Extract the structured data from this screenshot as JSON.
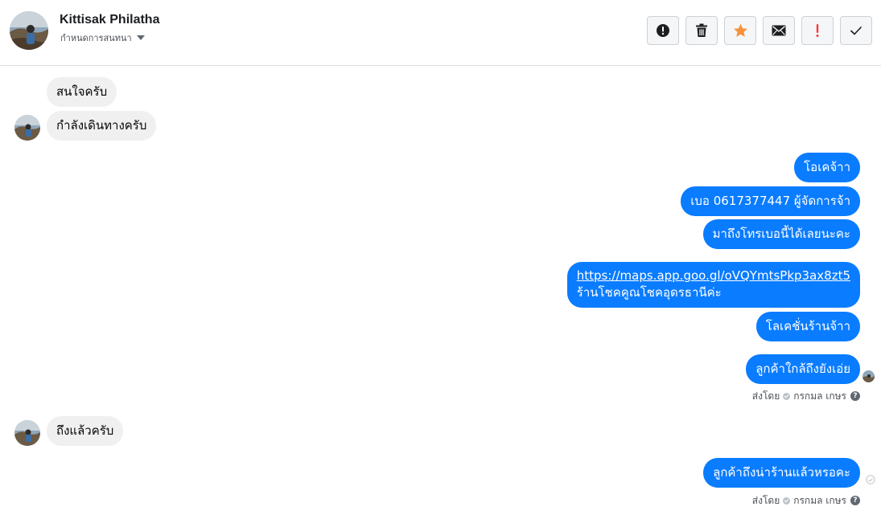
{
  "header": {
    "contact_name": "Kittisak Philatha",
    "assign_label": "กำหนดการสนทนา",
    "toolbar": [
      {
        "icon": "alert-circle-icon",
        "label": "spam"
      },
      {
        "icon": "trash-icon",
        "label": "delete"
      },
      {
        "icon": "star-icon",
        "label": "follow up"
      },
      {
        "icon": "envelope-icon",
        "label": "mark as unread"
      },
      {
        "icon": "exclamation-icon",
        "label": "priority"
      },
      {
        "icon": "checkmark-icon",
        "label": "mark as done"
      }
    ]
  },
  "colors": {
    "outgoing_bubble": "#0a7cff",
    "incoming_bubble": "#f1f0f0",
    "star": "#f7923b",
    "priority": "#fa383e"
  },
  "messages": [
    {
      "direction": "in",
      "text": "สนใจครับ"
    },
    {
      "direction": "in",
      "text": "กำลังเดินทางครับ"
    },
    {
      "direction": "out",
      "text": "โอเคจ้าา"
    },
    {
      "direction": "out",
      "text": "เบอ 0617377447 ผู้จัดการจ้า"
    },
    {
      "direction": "out",
      "text": "มาถึงโทรเบอนี้ได้เลยนะคะ"
    },
    {
      "direction": "out",
      "link": "https://maps.app.goo.gl/oVQYmtsPkp3ax8zt5",
      "text": "ร้านโชคคูณโชคอุดรธานีค่ะ"
    },
    {
      "direction": "out",
      "text": "โลเคชั่นร้านจ้าา"
    },
    {
      "direction": "out",
      "text": "ลูกค้าใกล้ถึงยังเอ่ย"
    },
    {
      "direction": "in",
      "text": "ถึงแล้วครับ"
    },
    {
      "direction": "out",
      "text": "ลูกค้าถึงน่าร้านแล้วหรอคะ"
    }
  ],
  "sent_by": {
    "prefix": "ส่งโดย",
    "name": "กรกมล เกษร",
    "help": "?"
  }
}
